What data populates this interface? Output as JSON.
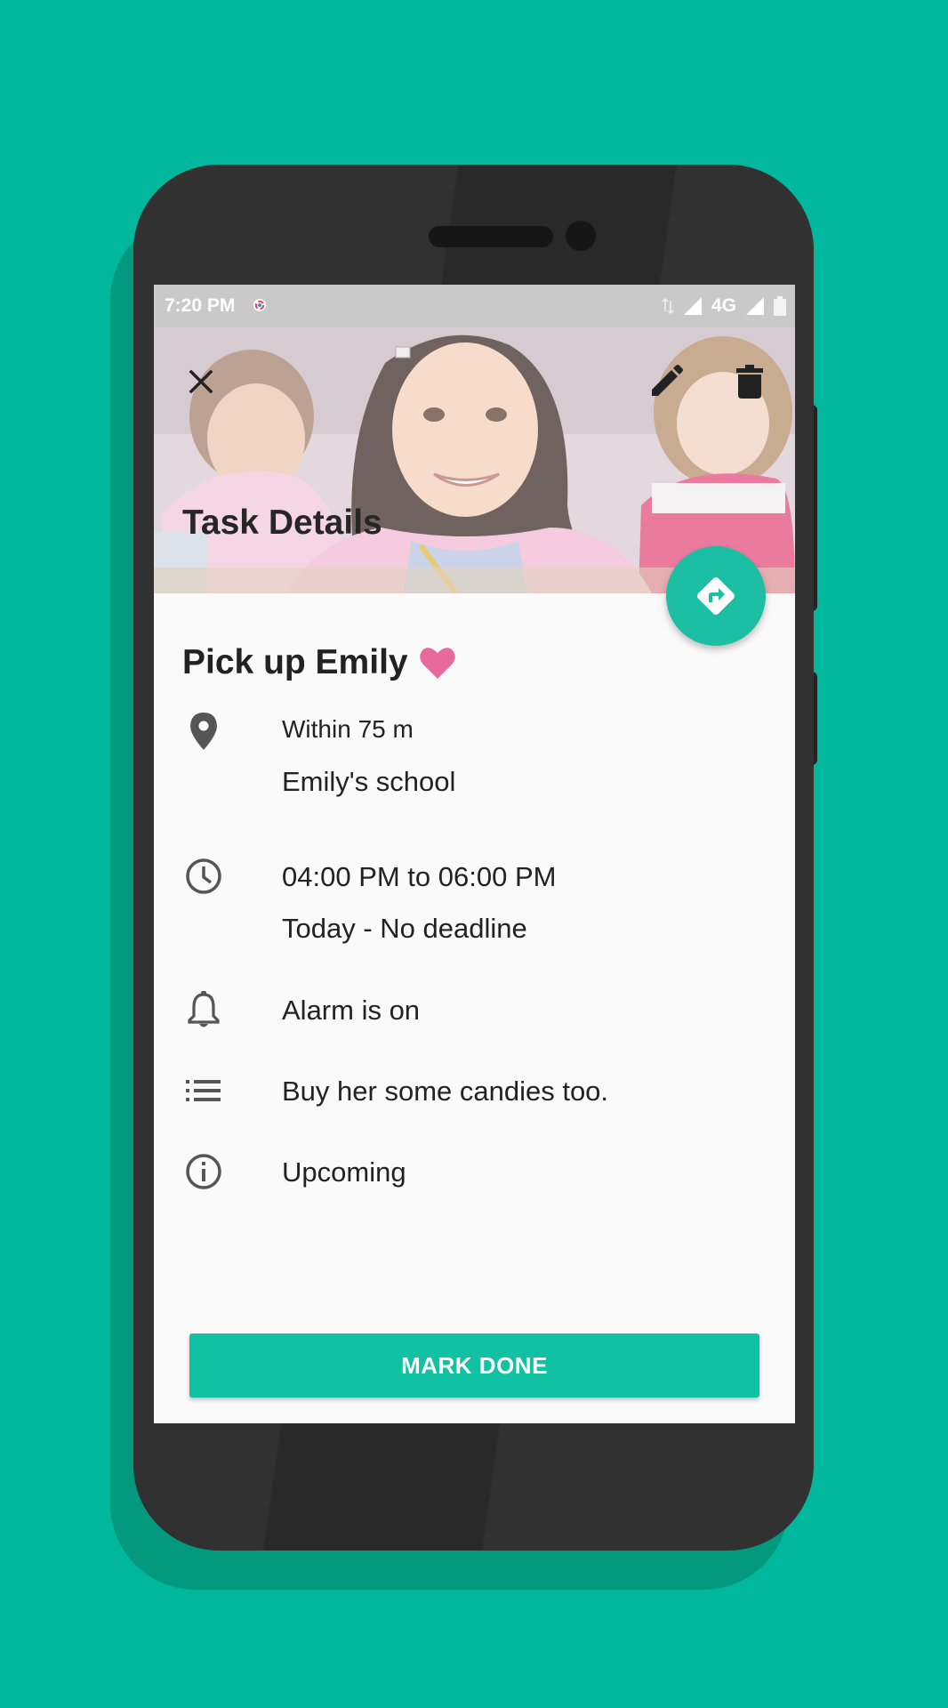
{
  "status_bar": {
    "time": "7:20 PM",
    "network": "4G"
  },
  "header": {
    "title": "Task Details",
    "close_icon": "close-icon",
    "edit_icon": "pencil-icon",
    "delete_icon": "trash-icon"
  },
  "fab": {
    "icon": "directions-icon"
  },
  "task": {
    "title": "Pick up Emily",
    "favorite_icon": "heart-icon",
    "location_radius": "Within 75 m",
    "location_name": "Emily's school",
    "time_range": "04:00 PM to 06:00 PM",
    "date_info": "Today - No deadline",
    "alarm": "Alarm is on",
    "note": "Buy her some candies too.",
    "status": "Upcoming"
  },
  "actions": {
    "mark_done_label": "MARK DONE"
  },
  "colors": {
    "background": "#01b79d",
    "accent": "#1cbfa3",
    "heart": "#e66a9b",
    "icon_gray": "#555555"
  }
}
